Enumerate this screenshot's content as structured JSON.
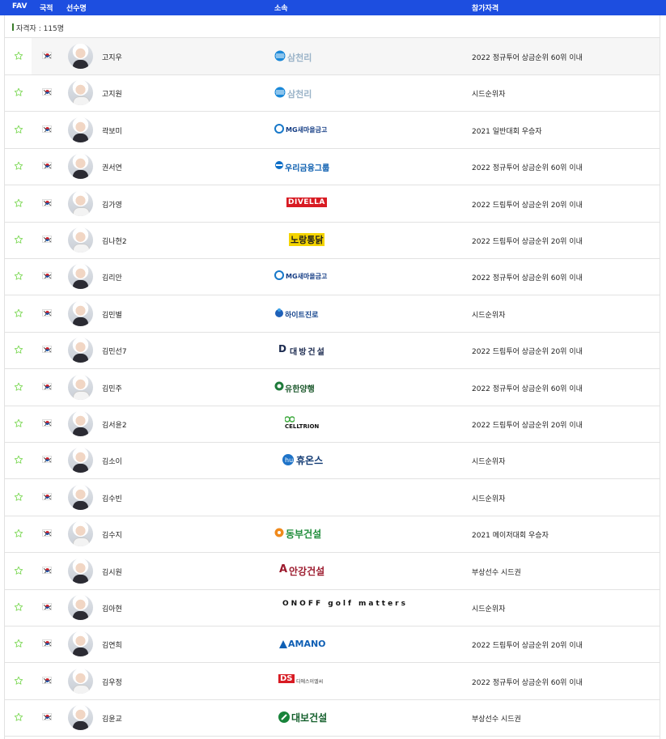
{
  "header": {
    "fav": "FAV",
    "nation": "국적",
    "name": "선수명",
    "affiliation": "소속",
    "qualification": "참가자격"
  },
  "count_label": "자격자 : 115명",
  "colors": {
    "header_bg": "#1d4ee0",
    "star_outline": "#7ed957",
    "row_border": "#e2e2e2"
  },
  "players": [
    {
      "name": "고지우",
      "sponsor": "삼천리",
      "sponsor_logo": "samchully-logo",
      "qualification": "2022 정규투어 상금순위 60위 이내"
    },
    {
      "name": "고지원",
      "sponsor": "삼천리",
      "sponsor_logo": "samchully-logo",
      "qualification": "시드순위자"
    },
    {
      "name": "곽보미",
      "sponsor": "MG새마을금고",
      "sponsor_logo": "mg-logo",
      "qualification": "2021 일반대회 우승자"
    },
    {
      "name": "권서연",
      "sponsor": "우리금융그룹",
      "sponsor_logo": "woori-logo",
      "qualification": "2022 정규투어 상금순위 60위 이내"
    },
    {
      "name": "김가영",
      "sponsor": "DIVELLA",
      "sponsor_logo": "divella-logo",
      "qualification": "2022 드림투어 상금순위 20위 이내"
    },
    {
      "name": "김나현2",
      "sponsor": "노랑통닭",
      "sponsor_logo": "norang-logo",
      "qualification": "2022 드림투어 상금순위 20위 이내"
    },
    {
      "name": "김리안",
      "sponsor": "MG새마을금고",
      "sponsor_logo": "mg-logo",
      "qualification": "2022 정규투어 상금순위 60위 이내"
    },
    {
      "name": "김민별",
      "sponsor": "하이트진로",
      "sponsor_logo": "hitejinro-logo",
      "qualification": "시드순위자"
    },
    {
      "name": "김민선7",
      "sponsor": "대방건설",
      "sponsor_logo": "daebang-logo",
      "qualification": "2022 드림투어 상금순위 20위 이내"
    },
    {
      "name": "김민주",
      "sponsor": "유한양행",
      "sponsor_logo": "yuhan-logo",
      "qualification": "2022 정규투어 상금순위 60위 이내"
    },
    {
      "name": "김서윤2",
      "sponsor": "CELLTRION",
      "sponsor_logo": "celltrion-logo",
      "qualification": "2022 드림투어 상금순위 20위 이내"
    },
    {
      "name": "김소이",
      "sponsor": "휴온스",
      "sponsor_logo": "huons-logo",
      "qualification": "시드순위자"
    },
    {
      "name": "김수빈",
      "sponsor": "",
      "sponsor_logo": "",
      "qualification": "시드순위자"
    },
    {
      "name": "김수지",
      "sponsor": "동부건설",
      "sponsor_logo": "dongbu-logo",
      "qualification": "2021 메이저대회 우승자"
    },
    {
      "name": "김시원",
      "sponsor": "안강건설",
      "sponsor_logo": "angang-logo",
      "qualification": "부상선수 시드권"
    },
    {
      "name": "김아현",
      "sponsor": "ONOFF golf matters",
      "sponsor_logo": "onoff-logo",
      "qualification": "시드순위자"
    },
    {
      "name": "김연희",
      "sponsor": "AMANO",
      "sponsor_logo": "amano-logo",
      "qualification": "2022 드림투어 상금순위 20위 이내"
    },
    {
      "name": "김우정",
      "sponsor": "DS 디에스이엘씨",
      "sponsor_logo": "ds-logo",
      "qualification": "2022 정규투어 상금순위 60위 이내"
    },
    {
      "name": "김윤교",
      "sponsor": "대보건설",
      "sponsor_logo": "daebo-logo",
      "qualification": "부상선수 시드권"
    }
  ]
}
